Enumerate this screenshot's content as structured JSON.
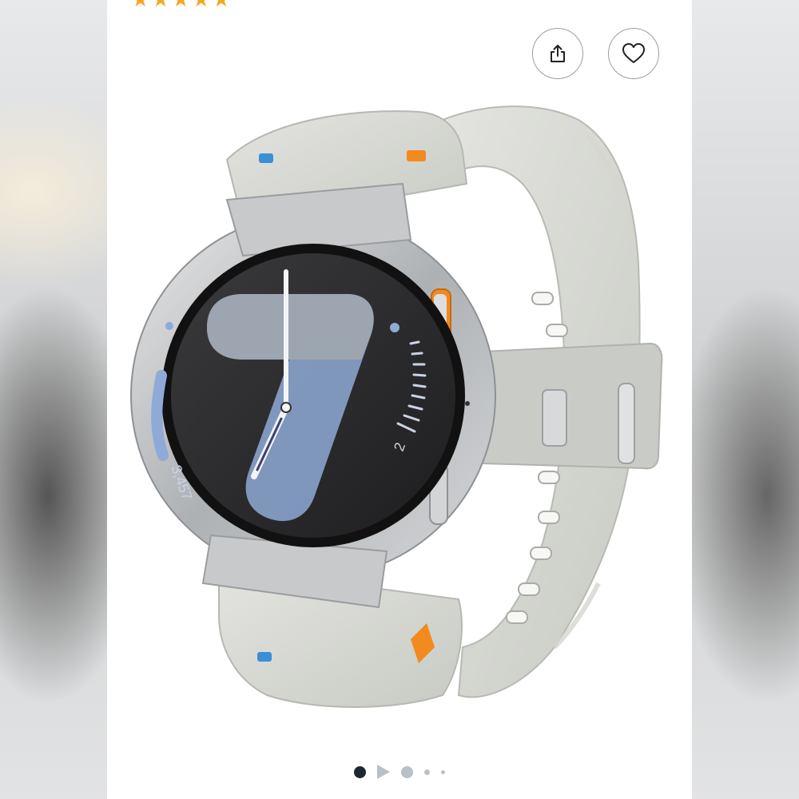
{
  "product": {
    "rating_stars": 5
  },
  "actions": {
    "share_icon": "share-icon",
    "favorite_icon": "heart-icon"
  },
  "image": {
    "watch_face_steps": "3,457",
    "watch_face_number": "2"
  },
  "carousel": {
    "total": 5,
    "active_index": 0
  },
  "colors": {
    "star": "#f5a623",
    "active_dot": "#1e2730",
    "inactive_dot": "#b8c0c8"
  }
}
